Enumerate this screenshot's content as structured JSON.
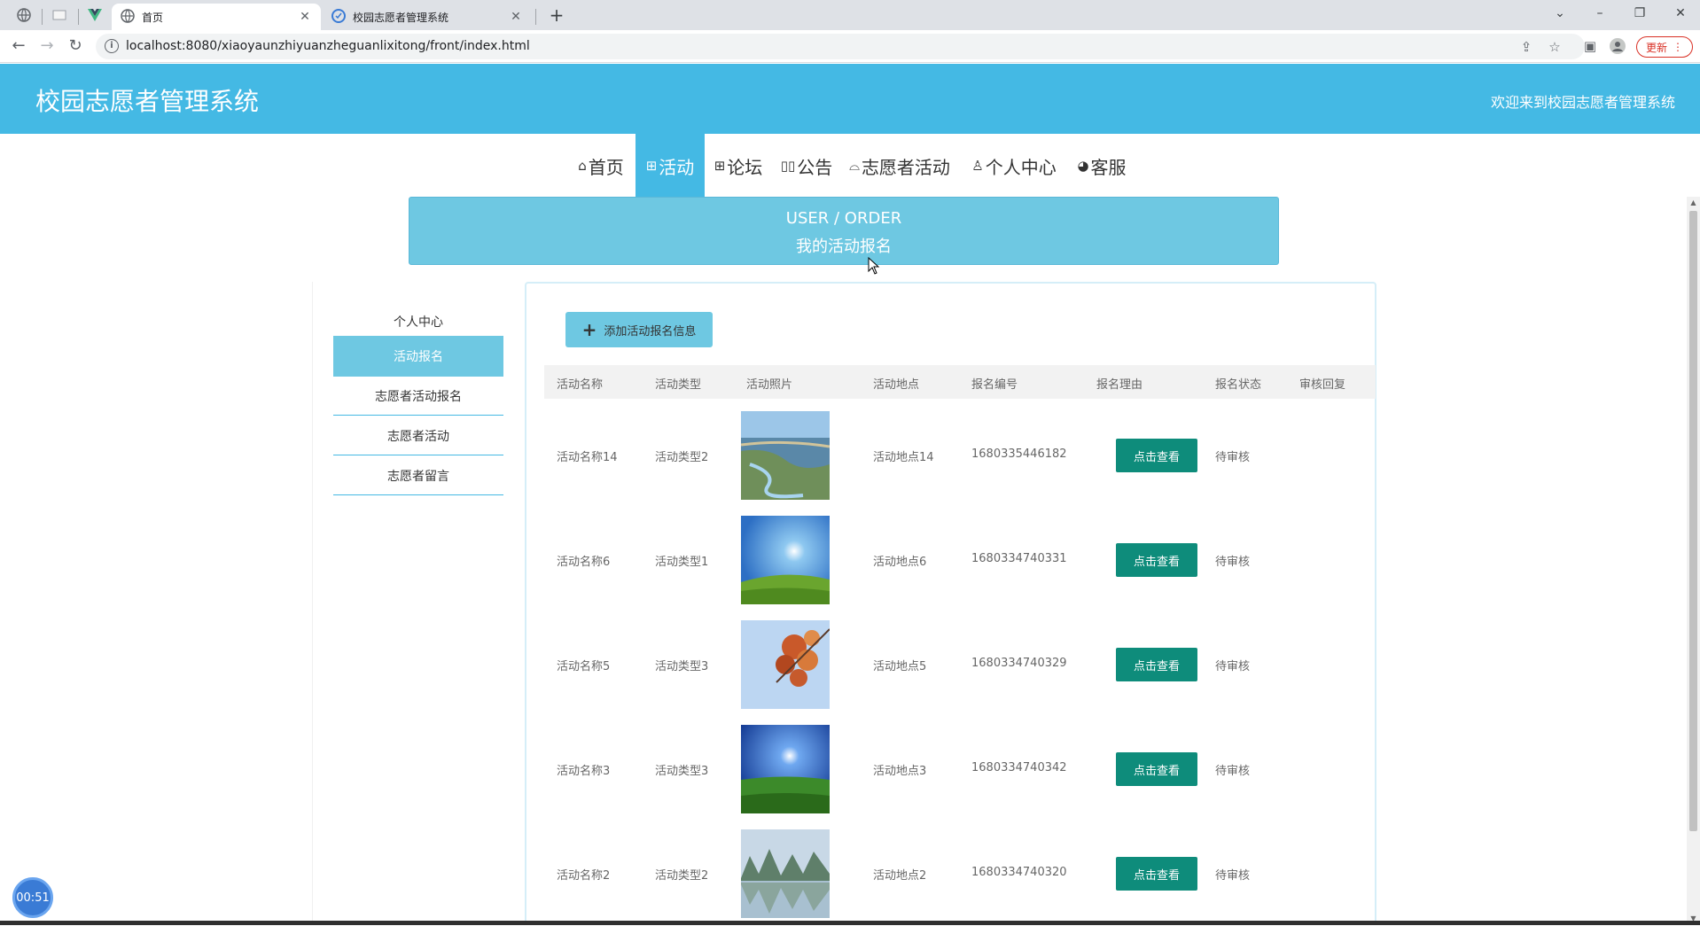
{
  "browser": {
    "tabs": [
      {
        "title": "首页",
        "active": true
      },
      {
        "title": "校园志愿者管理系统",
        "active": false
      }
    ],
    "url": "localhost:8080/xiaoyaunzhiyuanzheguanlixitong/front/index.html",
    "update_label": "更新"
  },
  "header": {
    "title": "校园志愿者管理系统",
    "welcome": "欢迎来到校园志愿者管理系统"
  },
  "nav": [
    {
      "label": "首页",
      "icon": "⌂",
      "active": false
    },
    {
      "label": "活动",
      "icon": "⊞",
      "active": true
    },
    {
      "label": "论坛",
      "icon": "⊞",
      "active": false
    },
    {
      "label": "公告",
      "icon": "▯▯",
      "active": false
    },
    {
      "label": "志愿者活动",
      "icon": "⌓",
      "active": false
    },
    {
      "label": "个人中心",
      "icon": "♙",
      "active": false
    },
    {
      "label": "客服",
      "icon": "◕",
      "active": false
    }
  ],
  "banner": {
    "en": "USER / ORDER",
    "cn": "我的活动报名"
  },
  "sidebar": {
    "items": [
      {
        "label": "个人中心"
      },
      {
        "label": "活动报名"
      },
      {
        "label": "志愿者活动报名"
      },
      {
        "label": "志愿者活动"
      },
      {
        "label": "志愿者留言"
      }
    ]
  },
  "toolbar": {
    "add_label": "添加活动报名信息"
  },
  "table": {
    "headers": [
      "活动名称",
      "活动类型",
      "活动照片",
      "活动地点",
      "报名编号",
      "报名理由",
      "报名状态",
      "审核回复"
    ],
    "view_label": "点击查看",
    "rows": [
      {
        "name": "活动名称14",
        "type": "活动类型2",
        "location": "活动地点14",
        "number": "1680335446182",
        "status": "待审核"
      },
      {
        "name": "活动名称6",
        "type": "活动类型1",
        "location": "活动地点6",
        "number": "1680334740331",
        "status": "待审核"
      },
      {
        "name": "活动名称5",
        "type": "活动类型3",
        "location": "活动地点5",
        "number": "1680334740329",
        "status": "待审核"
      },
      {
        "name": "活动名称3",
        "type": "活动类型3",
        "location": "活动地点3",
        "number": "1680334740342",
        "status": "待审核"
      },
      {
        "name": "活动名称2",
        "type": "活动类型2",
        "location": "活动地点2",
        "number": "1680334740320",
        "status": "待审核"
      }
    ]
  },
  "timer": "00:51",
  "colors": {
    "header_bg": "#44b9e4",
    "accent_light": "#6ec8e2",
    "view_button": "#0e8c7b"
  }
}
